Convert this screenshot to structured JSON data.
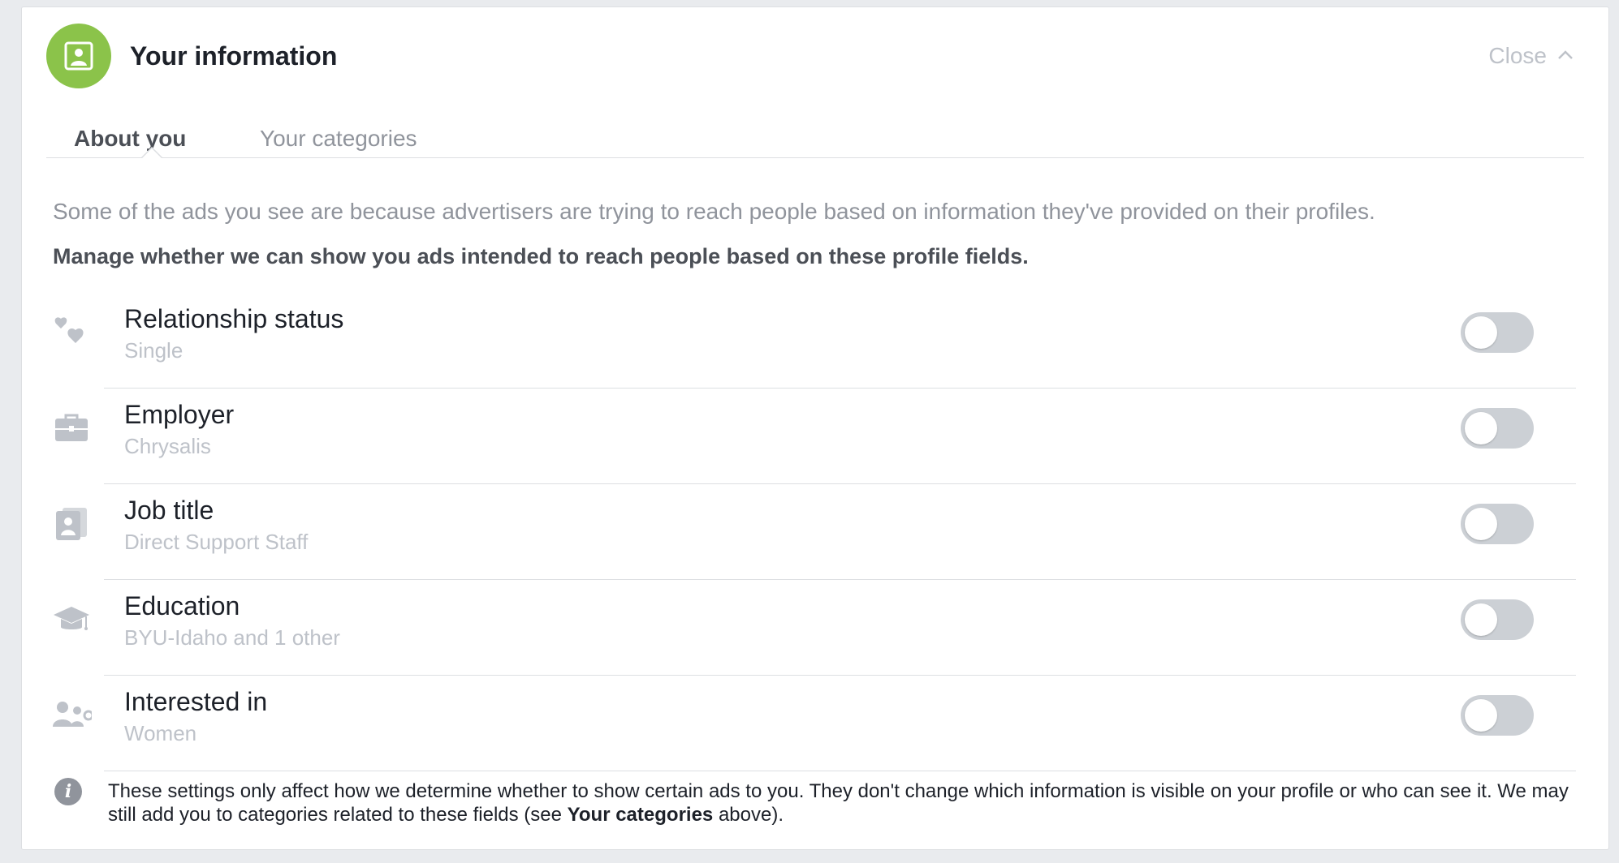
{
  "header": {
    "title": "Your information",
    "close_label": "Close",
    "icon": "profile-badge-icon",
    "accent_color": "#8bc34a"
  },
  "tabs": [
    {
      "label": "About you",
      "active": true
    },
    {
      "label": "Your categories",
      "active": false
    }
  ],
  "intro": {
    "text": "Some of the ads you see are because advertisers are trying to reach people based on information they've provided on their profiles.",
    "bold_text": "Manage whether we can show you ads intended to reach people based on these profile fields."
  },
  "fields": [
    {
      "title": "Relationship status",
      "value": "Single",
      "icon": "hearts-icon",
      "enabled": false
    },
    {
      "title": "Employer",
      "value": "Chrysalis",
      "icon": "briefcase-icon",
      "enabled": false
    },
    {
      "title": "Job title",
      "value": "Direct Support Staff",
      "icon": "id-card-icon",
      "enabled": false
    },
    {
      "title": "Education",
      "value": "BYU-Idaho and 1 other",
      "icon": "graduation-cap-icon",
      "enabled": false
    },
    {
      "title": "Interested in",
      "value": "Women",
      "icon": "people-icon",
      "enabled": false
    }
  ],
  "footer": {
    "icon": "info-icon",
    "text_part1": "These settings only affect how we determine whether to show certain ads to you. They don't change which information is visible on your profile or who can see it. We may still add you to categories related to these fields (see ",
    "text_bold": "Your categories",
    "text_part2": " above)."
  }
}
